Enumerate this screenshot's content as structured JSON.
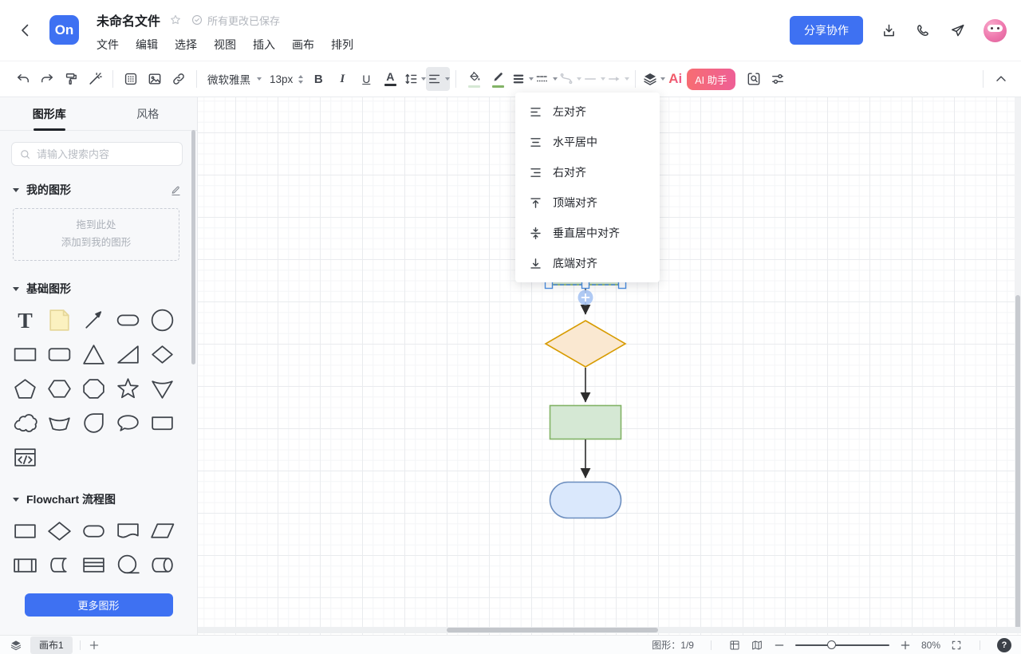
{
  "colors": {
    "accent": "#3e71f2",
    "selection": "#4d8fe2",
    "ai_gradient_start": "#f76d72",
    "ai_gradient_end": "#ee5f96",
    "diamond_fill": "#fae8d1",
    "diamond_stroke": "#d79b00",
    "process_fill": "#d5e8d4",
    "process_stroke": "#82b366",
    "terminator_fill": "#dae8fc",
    "terminator_stroke": "#6c8ebf",
    "sticky_fill": "#fbf1c0",
    "sticky_stroke": "#e6d79a"
  },
  "header": {
    "logo": "On",
    "title": "未命名文件",
    "saved": "所有更改已保存",
    "menu": [
      "文件",
      "编辑",
      "选择",
      "视图",
      "插入",
      "画布",
      "排列"
    ],
    "share": "分享协作"
  },
  "toolbar": {
    "font_family": "微软雅黑",
    "font_size": "13px",
    "bold": "B",
    "italic": "I",
    "underline": "U",
    "font_color": "A",
    "ai_logo": "Ai",
    "ai_assistant": "AI 助手"
  },
  "align_menu": {
    "items": [
      {
        "label": "左对齐"
      },
      {
        "label": "水平居中"
      },
      {
        "label": "右对齐"
      },
      {
        "label": "顶端对齐"
      },
      {
        "label": "垂直居中对齐"
      },
      {
        "label": "底端对齐"
      }
    ]
  },
  "sidebar": {
    "tab_library": "图形库",
    "tab_style": "风格",
    "search_placeholder": "请输入搜索内容",
    "my_shapes_title": "我的图形",
    "drop_hint_line1": "拖到此处",
    "drop_hint_line2": "添加到我的图形",
    "basic_shapes_title": "基础图形",
    "flowchart_title": "Flowchart 流程图",
    "more_shapes": "更多图形"
  },
  "statusbar": {
    "canvas_tab": "画布1",
    "shape_count": "图形：1/9",
    "zoom": "80%"
  }
}
